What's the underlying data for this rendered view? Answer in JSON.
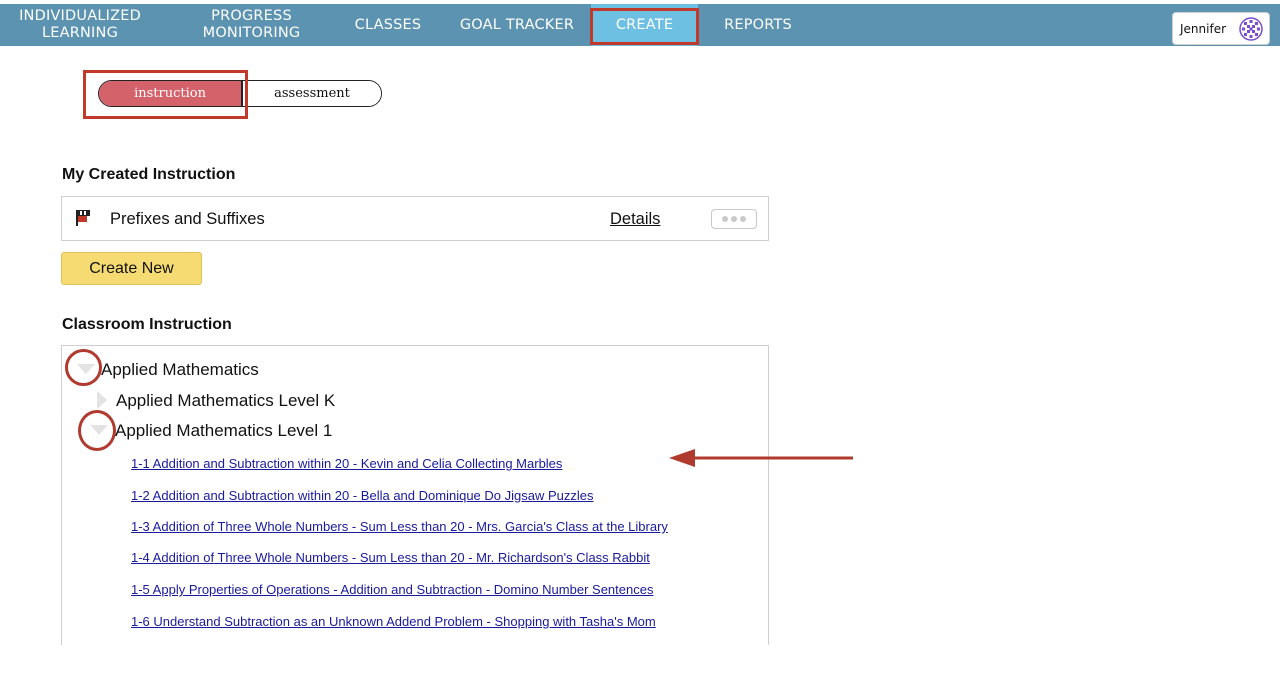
{
  "nav": {
    "items": [
      {
        "line1": "Individualized",
        "line2": "Learning"
      },
      {
        "line1": "Progress",
        "line2": "Monitoring"
      },
      {
        "line1": "Classes",
        "line2": ""
      },
      {
        "line1": "Goal Tracker",
        "line2": ""
      },
      {
        "line1": "Create",
        "line2": ""
      },
      {
        "line1": "Reports",
        "line2": ""
      }
    ],
    "active": "Create",
    "user_name": "Jennifer",
    "colors": {
      "bar": "#5b93b1",
      "active": "#6ec0e3"
    }
  },
  "toggle": {
    "instruction_label": "instruction",
    "assessment_label": "assessment",
    "selected": "instruction"
  },
  "my_created": {
    "title": "My Created Instruction",
    "items": [
      {
        "name": "Prefixes and Suffixes",
        "details_label": "Details"
      }
    ],
    "create_new_label": "Create New"
  },
  "classroom": {
    "title": "Classroom Instruction",
    "tree": {
      "root": "Applied Mathematics",
      "level_k": "Applied Mathematics Level K",
      "level_1": "Applied Mathematics Level 1",
      "lessons": [
        "1-1 Addition and Subtraction within 20 - Kevin and Celia Collecting Marbles",
        "1-2 Addition and Subtraction within 20 - Bella and Dominique Do Jigsaw Puzzles",
        "1-3 Addition of Three Whole Numbers - Sum Less than 20 - Mrs. Garcia's Class at the Library",
        "1-4 Addition of Three Whole Numbers - Sum Less than 20 - Mr. Richardson's Class Rabbit",
        "1-5 Apply Properties of Operations - Addition and Subtraction - Domino Number Sentences",
        "1-6 Understand Subtraction as an Unknown Addend Problem - Shopping with Tasha's Mom"
      ]
    }
  },
  "colors": {
    "instruction_pill": "#d4626a",
    "create_button": "#f6db72",
    "annotation": "#c0392b",
    "link": "#1a1a9c"
  }
}
